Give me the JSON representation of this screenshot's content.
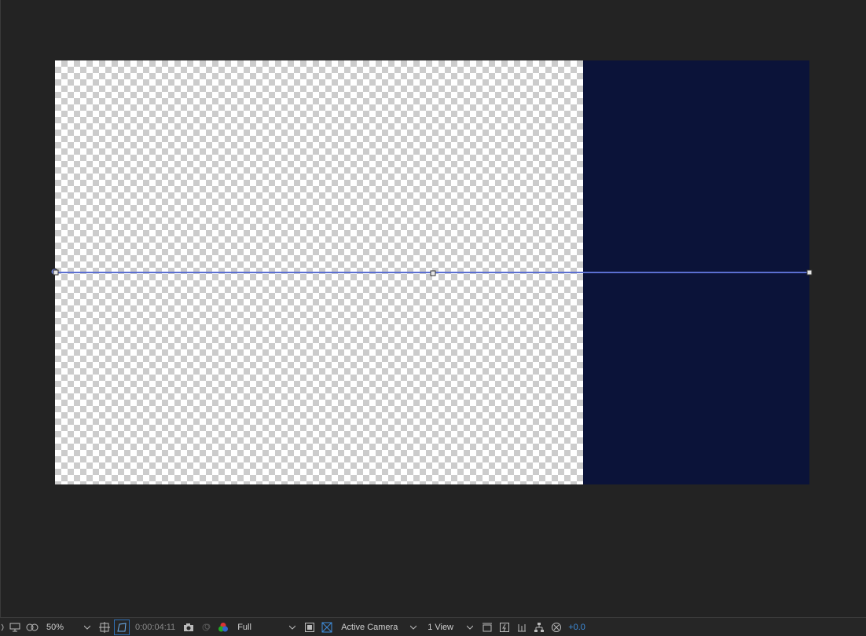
{
  "viewer": {
    "solid_color": "#0b1339",
    "path_color": "#5b6fd1"
  },
  "toolbar": {
    "magnification": "50%",
    "timecode": "0:00:04:11",
    "resolution": "Full",
    "camera": "Active Camera",
    "views": "1 View",
    "exposure": "+0.0"
  }
}
